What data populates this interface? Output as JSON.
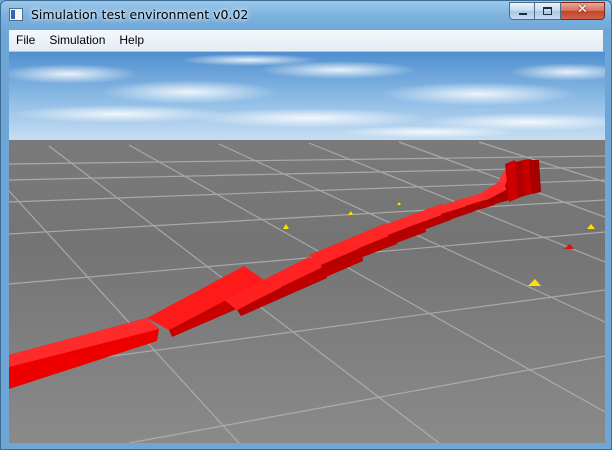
{
  "window": {
    "title": "Simulation test environment v0.02"
  },
  "caption": {
    "close_symbol": "✕"
  },
  "menu": {
    "items": [
      "File",
      "Simulation",
      "Help"
    ]
  },
  "scene": {
    "sky_color": "#7fb0dc",
    "ground_color": "#6a6a6a",
    "domino_color": "#ff0000",
    "marker_color": "#ffe000"
  }
}
